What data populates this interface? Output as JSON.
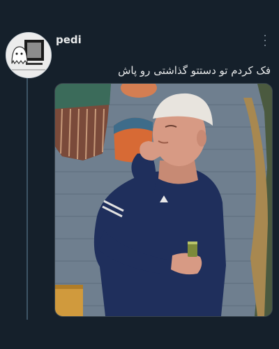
{
  "user": {
    "name": "pedi",
    "avatar_icon": "ghost-icon"
  },
  "menu": {
    "icon": "more-options-icon"
  },
  "tweet": {
    "text": "فک کردم تو دستتو گذاشتی رو پاش"
  },
  "media": {
    "type": "photo",
    "colors": {
      "wall": "#6f7f8f",
      "sweater": "#1f2f5c",
      "skin": "#d79a84",
      "cap": "#e8e4de"
    }
  }
}
